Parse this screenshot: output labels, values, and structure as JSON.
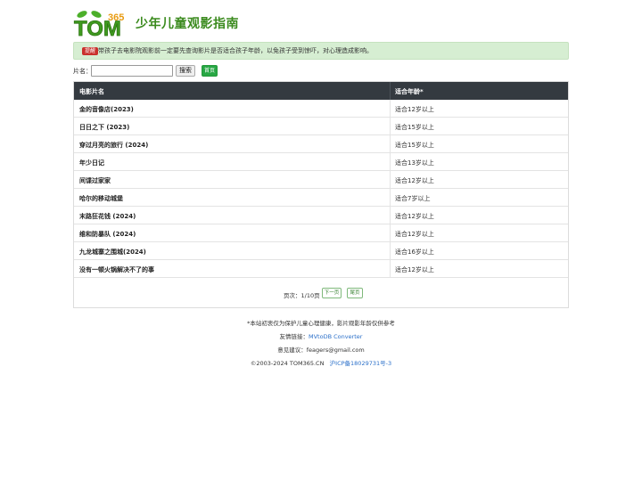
{
  "header": {
    "logo_text": "TOM",
    "logo_number": "365",
    "title": "少年儿童观影指南"
  },
  "notice": {
    "badge": "提醒",
    "text": "带孩子去电影院观影前一定要先查询影片是否适合孩子年龄，以免孩子受到惊吓，对心理造成影响。"
  },
  "search": {
    "label": "片名：",
    "value": "",
    "placeholder": "",
    "button_label": "搜索",
    "home_label": "首页"
  },
  "table": {
    "columns": [
      "电影片名",
      "适合年龄*"
    ],
    "rows": [
      {
        "name": "金的音像店(2023)",
        "age": "适合12岁以上"
      },
      {
        "name": "日日之下 (2023)",
        "age": "适合15岁以上"
      },
      {
        "name": "穿过月亮的旅行 (2024)",
        "age": "适合15岁以上"
      },
      {
        "name": "年少日记",
        "age": "适合13岁以上"
      },
      {
        "name": "间谍过家家",
        "age": "适合12岁以上"
      },
      {
        "name": "哈尔的移动城堡",
        "age": "适合7岁以上"
      },
      {
        "name": "末路狂花钱 (2024)",
        "age": "适合12岁以上"
      },
      {
        "name": "维和防暴队 (2024)",
        "age": "适合12岁以上"
      },
      {
        "name": "九龙城寨之围城(2024)",
        "age": "适合16岁以上"
      },
      {
        "name": "没有一顿火锅解决不了的事",
        "age": "适合12岁以上"
      }
    ]
  },
  "pager": {
    "text": "页次：1/10页",
    "next_label": "下一页",
    "last_label": "尾页"
  },
  "footer": {
    "disclaimer": "*本站初衷仅为保护儿童心理健康，影片观影年龄仅供参考",
    "friend_prefix": "友情链接：",
    "friend_link": "MVtoDB Converter",
    "feedback": "意见建议：feagers@gmail.com",
    "copyright": "©2003-2024    TOM365.CN",
    "icp": "沪ICP备18029731号-3"
  },
  "colors": {
    "accent_green": "#3a8a1d",
    "notice_bg": "#d6eed2",
    "table_header_bg": "#343a40",
    "badge_red": "#c9302c",
    "link_blue": "#2a6fc9"
  }
}
